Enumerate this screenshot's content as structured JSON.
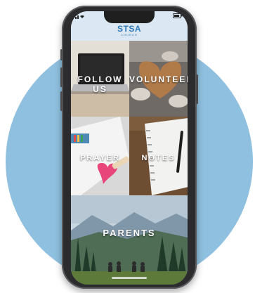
{
  "status": {
    "time": "",
    "battery": ""
  },
  "header": {
    "logo": "STSA",
    "logo_sub": "CHURCH"
  },
  "tiles": [
    {
      "label": "FOLLOW US"
    },
    {
      "label": "VOLUNTEER"
    },
    {
      "label": "PRAYER"
    },
    {
      "label": "NOTES"
    },
    {
      "label": "PARENTS"
    }
  ],
  "colors": {
    "background_circle": "#8fc0df",
    "accent": "#2f79b9",
    "header_bg": "#dbe8f3"
  }
}
